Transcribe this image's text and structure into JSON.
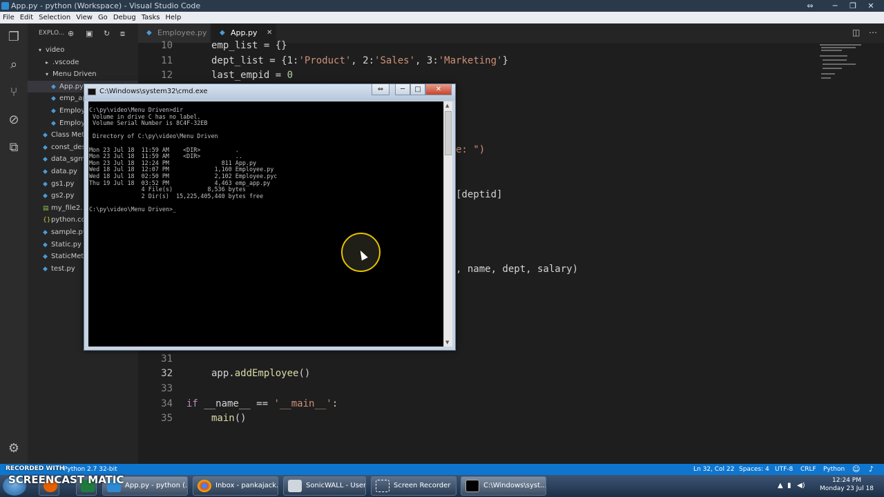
{
  "window": {
    "title": "App.py - python (Workspace) - Visual Studio Code"
  },
  "menu": [
    "File",
    "Edit",
    "Selection",
    "View",
    "Go",
    "Debug",
    "Tasks",
    "Help"
  ],
  "activity_icons": [
    "files-icon",
    "search-icon",
    "source-control-icon",
    "debug-icon",
    "extensions-icon",
    "gear-icon"
  ],
  "sidebar": {
    "header": "EXPLO...",
    "tree": [
      {
        "label": "video",
        "caret": "▾",
        "icon": ""
      },
      {
        "label": ".vscode",
        "caret": "▸",
        "icon": ""
      },
      {
        "label": "Menu Driven",
        "caret": "▾",
        "icon": ""
      },
      {
        "label": "App.py",
        "caret": "",
        "icon": "◆"
      },
      {
        "label": "emp_ap",
        "caret": "",
        "icon": "◆"
      },
      {
        "label": "Employ",
        "caret": "",
        "icon": "◆"
      },
      {
        "label": "Employ",
        "caret": "",
        "icon": "◆"
      },
      {
        "label": "Class Met",
        "caret": "",
        "icon": "◆"
      },
      {
        "label": "const_des",
        "caret": "",
        "icon": "◆"
      },
      {
        "label": "data_sgm",
        "caret": "",
        "icon": "◆"
      },
      {
        "label": "data.py",
        "caret": "",
        "icon": "◆"
      },
      {
        "label": "gs1.py",
        "caret": "",
        "icon": "◆"
      },
      {
        "label": "gs2.py",
        "caret": "",
        "icon": "◆"
      },
      {
        "label": "my_file2.",
        "caret": "",
        "icon": "▤"
      },
      {
        "label": "python.co",
        "caret": "",
        "icon": "{}"
      },
      {
        "label": "sample.py",
        "caret": "",
        "icon": "◆"
      },
      {
        "label": "Static.py",
        "caret": "",
        "icon": "◆"
      },
      {
        "label": "StaticMet",
        "caret": "",
        "icon": "◆"
      },
      {
        "label": "test.py",
        "caret": "",
        "icon": "◆"
      }
    ]
  },
  "tabs": [
    {
      "label": "Employee.py"
    },
    {
      "label": "App.py",
      "close": "✕"
    }
  ],
  "editor": {
    "line_numbers": [
      "10",
      "11",
      "12",
      "31",
      "32",
      "33",
      "34",
      "35"
    ],
    "lines": {
      "l10": "emp_list = {}",
      "l11_a": "dept_list = {1:",
      "l11_b": "'Product'",
      "l11_c": ", 2:",
      "l11_d": "'Sales'",
      "l11_e": ", 3:",
      "l11_f": "'Marketing'",
      "l11_g": "}",
      "l12_a": "last_empid = ",
      "l12_b": "0",
      "frag1": "e: \")",
      "frag2": "[deptid]",
      "frag3": ", name, dept, salary)",
      "l32_a": "app.",
      "l32_b": "addEmployee",
      "l32_c": "()",
      "l34_a": "if",
      "l34_b": " __name__ == ",
      "l34_c": "'__main__'",
      "l34_d": ":",
      "l35_a": "main",
      "l35_b": "()"
    }
  },
  "cmd": {
    "title": "C:\\Windows\\system32\\cmd.exe",
    "output": "C:\\py\\video\\Menu Driven>dir\n Volume in drive C has no label.\n Volume Serial Number is 8C4F-32EB\n\n Directory of C:\\py\\video\\Menu Driven\n\nMon 23 Jul 18  11:59 AM    <DIR>          .\nMon 23 Jul 18  11:59 AM    <DIR>          ..\nMon 23 Jul 18  12:24 PM               811 App.py\nWed 18 Jul 18  12:07 PM             1,160 Employee.py\nWed 18 Jul 18  02:50 PM             2,102 Employee.pyc\nThu 19 Jul 18  03:52 PM             4,463 emp_app.py\n               4 File(s)          8,536 bytes\n               2 Dir(s)  15,225,405,440 bytes free\n\nC:\\py\\video\\Menu Driven>_"
  },
  "statusbar": {
    "python": "Python 2.7 32-bit",
    "position": "Ln 32, Col 22",
    "spaces": "Spaces: 4",
    "encoding": "UTF-8",
    "eol": "CRLF",
    "language": "Python"
  },
  "taskbar": {
    "items": [
      "App.py - python (...",
      "Inbox - pankajack...",
      "SonicWALL - User...",
      "Screen Recorder",
      "C:\\Windows\\syst..."
    ],
    "time": "12:24 PM",
    "date": "Monday 23 Jul 18"
  },
  "watermark": {
    "top": "RECORDED WITH",
    "brand": "SCREENCAST  MATIC"
  },
  "colors": {
    "statusbar": "#0e76cf",
    "editor_bg": "#1e1e1e",
    "sidebar_bg": "#252526",
    "string": "#ce9178"
  }
}
